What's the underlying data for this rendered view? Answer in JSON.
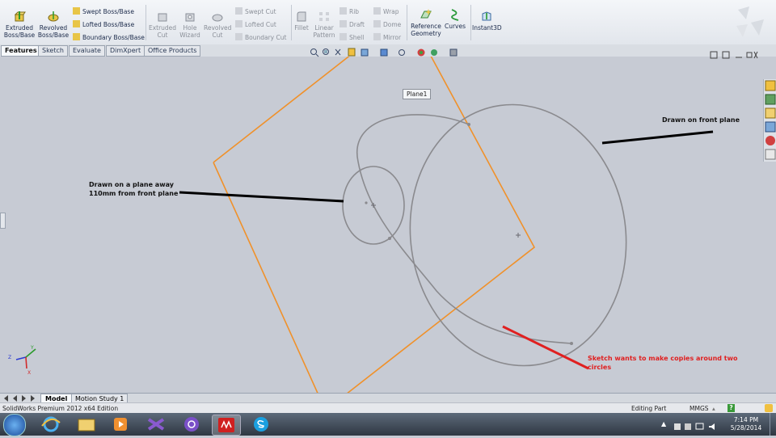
{
  "ribbon": {
    "features": {
      "extruded_boss": "Extruded Boss/Base",
      "revolved_boss": "Revolved Boss/Base",
      "swept_boss": "Swept Boss/Base",
      "lofted_boss": "Lofted Boss/Base",
      "boundary_boss": "Boundary Boss/Base",
      "extruded_cut": "Extruded Cut",
      "hole_wizard": "Hole Wizard",
      "revolved_cut": "Revolved Cut",
      "swept_cut": "Swept Cut",
      "lofted_cut": "Lofted Cut",
      "boundary_cut": "Boundary Cut",
      "fillet": "Fillet",
      "linear_pattern": "Linear Pattern",
      "rib": "Rib",
      "draft": "Draft",
      "shell": "Shell",
      "wrap": "Wrap",
      "dome": "Dome",
      "mirror": "Mirror",
      "reference_geometry": "Reference Geometry",
      "curves": "Curves",
      "instant3d": "Instant3D"
    }
  },
  "command_tabs": [
    "Features",
    "Sketch",
    "Evaluate",
    "DimXpert",
    "Office Products"
  ],
  "graphics": {
    "plane_label": "Plane1",
    "annotation_front": "Drawn on front plane",
    "annotation_away_1": "Drawn on a plane away",
    "annotation_away_2": "110mm from front plane",
    "annotation_sketch_1": "Sketch wants to make copies around two",
    "annotation_sketch_2": "circles",
    "triad": {
      "x": "X",
      "y": "Y",
      "z": "Z"
    }
  },
  "bottom_tabs": [
    "Model",
    "Motion Study 1"
  ],
  "status": {
    "app": "SolidWorks Premium 2012 x64 Edition",
    "mode": "Editing Part",
    "units": "MMGS",
    "help": "?"
  },
  "taskbar": {
    "time": "7:14 PM",
    "date": "5/28/2014"
  },
  "colors": {
    "plane": "#f0912a",
    "sketch": "#8a8a8e",
    "annotation_red": "#e02020",
    "background": "#c7cbd4"
  }
}
